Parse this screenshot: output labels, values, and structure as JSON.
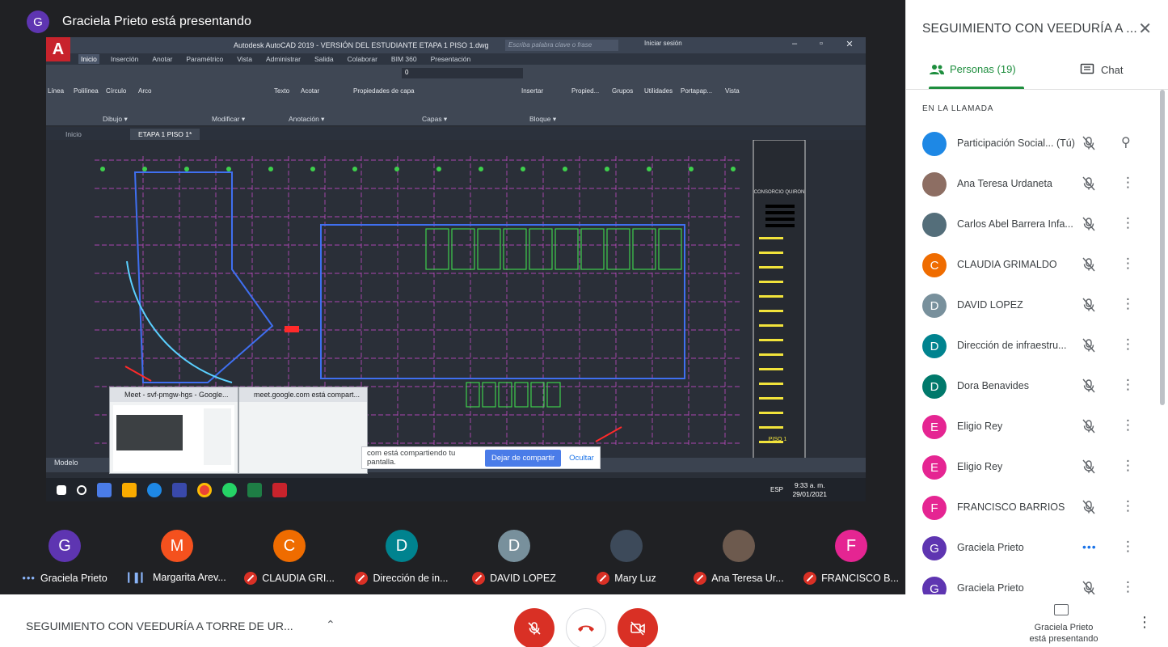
{
  "presenter": {
    "initial": "G",
    "color": "#5e35b1",
    "text": "Graciela Prieto está presentando"
  },
  "shared_screen": {
    "app_logo": "A",
    "title": "Autodesk AutoCAD 2019 - VERSIÓN DEL ESTUDIANTE   ETAPA 1 PISO 1.dwg",
    "search_placeholder": "Escriba palabra clave o frase",
    "login": "Iniciar sesión",
    "ribbon_tabs": [
      "Inicio",
      "Inserción",
      "Anotar",
      "Paramétrico",
      "Vista",
      "Administrar",
      "Salida",
      "Colaborar",
      "BIM 360",
      "Presentación"
    ],
    "ribbon_active": "Inicio",
    "ribbon_buttons": [
      "Línea",
      "Polilínea",
      "Círculo",
      "Arco",
      "Texto",
      "Acotar",
      "Propiedades de capa",
      "Insertar",
      "Propied...",
      "Grupos",
      "Utilidades",
      "Portapap...",
      "Vista"
    ],
    "layer_name": "0",
    "ribbon_groups": [
      "Dibujo ▾",
      "Modificar ▾",
      "Anotación ▾",
      "Capas ▾",
      "Bloque ▾"
    ],
    "doc_tabs": [
      "Inicio",
      "ETAPA 1 PISO 1*"
    ],
    "model_tab": "Modelo",
    "title_block": "CONSORCIO QUIRON",
    "sheet_label": "PISO 1",
    "taskbar_lang": "ESP",
    "taskbar_time": "9:33 a. m.",
    "taskbar_date": "29/01/2021",
    "popup_meet_title": "Meet - svf-pmgw-hgs - Google...",
    "popup_share_title": "meet.google.com está compart...",
    "share_strip_text": "com está compartiendo tu pantalla.",
    "stop_share": "Dejar de compartir",
    "hide": "Ocultar"
  },
  "tiles": [
    {
      "initial": "G",
      "color": "#5e35b1",
      "name": "Graciela Prieto",
      "state": "dots"
    },
    {
      "initial": "M",
      "color": "#f4511e",
      "name": "Margarita Arev...",
      "state": "speaking"
    },
    {
      "initial": "C",
      "color": "#ef6c00",
      "name": "CLAUDIA GRI...",
      "state": "muted"
    },
    {
      "initial": "D",
      "color": "#00838f",
      "name": "Dirección de in...",
      "state": "muted"
    },
    {
      "initial": "D",
      "color": "#78909c",
      "name": "DAVID LOPEZ",
      "state": "muted"
    },
    {
      "initial": "",
      "color": "#3d4a5a",
      "name": "Mary Luz",
      "state": "muted"
    },
    {
      "initial": "",
      "color": "#6d5a4e",
      "name": "Ana Teresa Ur...",
      "state": "muted"
    },
    {
      "initial": "F",
      "color": "#e52592",
      "name": "FRANCISCO B...",
      "state": "muted"
    }
  ],
  "bottom_bar": {
    "meeting_title": "SEGUIMIENTO CON VEEDURÍA A TORRE DE UR...",
    "presenting_line1": "Graciela Prieto",
    "presenting_line2": "está presentando"
  },
  "panel": {
    "title": "SEGUIMIENTO CON VEEDURÍA A ...",
    "tab_people": "Personas (19)",
    "tab_chat": "Chat",
    "section_label": "EN LA LLAMADA",
    "people": [
      {
        "initial": "",
        "color": "#1e88e5",
        "name": "Participación Social... (Tú)",
        "mic": "muted",
        "action": "pin"
      },
      {
        "initial": "",
        "color": "#8d6e63",
        "name": "Ana Teresa Urdaneta",
        "mic": "muted",
        "action": "more"
      },
      {
        "initial": "",
        "color": "#546e7a",
        "name": "Carlos Abel Barrera Infa...",
        "mic": "muted",
        "action": "more"
      },
      {
        "initial": "C",
        "color": "#ef6c00",
        "name": "CLAUDIA GRIMALDO",
        "mic": "muted",
        "action": "more"
      },
      {
        "initial": "D",
        "color": "#78909c",
        "name": "DAVID LOPEZ",
        "mic": "muted",
        "action": "more"
      },
      {
        "initial": "D",
        "color": "#00838f",
        "name": "Dirección de infraestru...",
        "mic": "muted",
        "action": "more"
      },
      {
        "initial": "D",
        "color": "#00796b",
        "name": "Dora Benavides",
        "mic": "muted",
        "action": "more"
      },
      {
        "initial": "E",
        "color": "#e52592",
        "name": "Eligio Rey",
        "mic": "muted",
        "action": "more"
      },
      {
        "initial": "E",
        "color": "#e52592",
        "name": "Eligio Rey",
        "mic": "muted",
        "action": "more"
      },
      {
        "initial": "F",
        "color": "#e52592",
        "name": "FRANCISCO BARRIOS",
        "mic": "muted",
        "action": "more"
      },
      {
        "initial": "G",
        "color": "#5e35b1",
        "name": "Graciela Prieto",
        "mic": "speaking",
        "action": "more"
      },
      {
        "initial": "G",
        "color": "#5e35b1",
        "name": "Graciela Prieto",
        "mic": "muted",
        "action": "more"
      }
    ]
  },
  "colors": {
    "accent_green": "#1e8e3e",
    "muted_red": "#d93025",
    "stage_bg": "#202124"
  }
}
